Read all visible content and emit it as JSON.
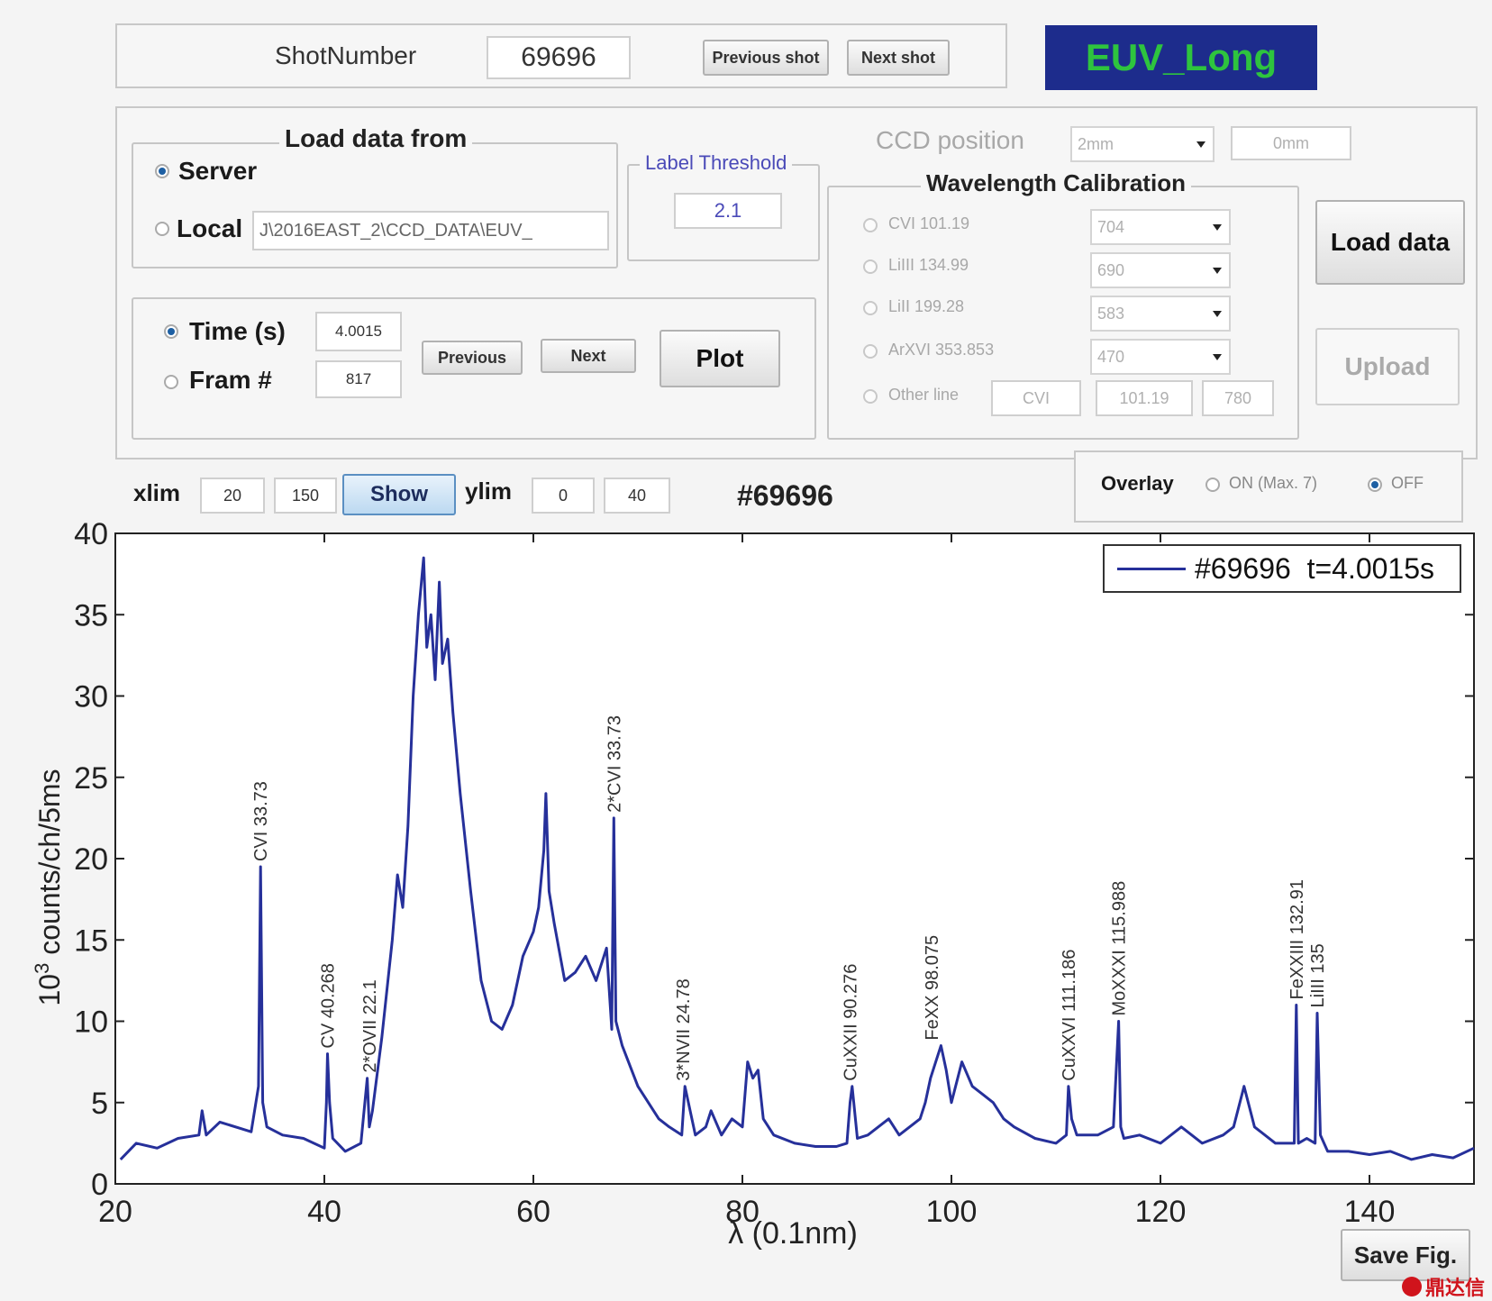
{
  "header": {
    "shot_label": "ShotNumber",
    "shot_value": "69696",
    "prev_shot": "Previous shot",
    "next_shot": "Next shot",
    "title": "EUV_Long",
    "title_bg": "#1d2c8c",
    "title_color": "#2ec43e"
  },
  "load_panel": {
    "title": "Load data from",
    "server_label": "Server",
    "local_label": "Local",
    "local_path": "J\\2016EAST_2\\CCD_DATA\\EUV_",
    "selected": "Server"
  },
  "threshold": {
    "title": "Label Threshold",
    "value": "2.1"
  },
  "ccd": {
    "label": "CCD position",
    "select_value": "2mm",
    "field_value": "0mm"
  },
  "calibration": {
    "title": "Wavelength Calibration",
    "lines": [
      {
        "label": "CVI 101.19",
        "value": "704"
      },
      {
        "label": "LiIII 134.99",
        "value": "690"
      },
      {
        "label": "LiII 199.28",
        "value": "583"
      },
      {
        "label": "ArXVI 353.853",
        "value": "470"
      }
    ],
    "other_label": "Other line",
    "other_values": [
      "CVI",
      "101.19",
      "780"
    ]
  },
  "buttons": {
    "load_data": "Load data",
    "upload": "Upload",
    "plot": "Plot",
    "previous": "Previous",
    "next": "Next",
    "show": "Show",
    "save_fig": "Save Fig."
  },
  "time_panel": {
    "time_label": "Time (s)",
    "time_value": "4.0015",
    "frame_label": "Fram #",
    "frame_value": "817",
    "selected": "Time (s)"
  },
  "limits": {
    "xlim_label": "xlim",
    "xlim_min": "20",
    "xlim_max": "150",
    "ylim_label": "ylim",
    "ylim_min": "0",
    "ylim_max": "40",
    "shot_tag": "#69696"
  },
  "overlay": {
    "label": "Overlay",
    "on_label": "ON (Max. 7)",
    "off_label": "OFF",
    "selected": "OFF"
  },
  "watermark": "鼎达信",
  "chart_data": {
    "type": "line",
    "xlabel": "λ (0.1nm)",
    "ylabel_base": "10",
    "ylabel_exp": "3",
    "ylabel_rest": " counts/ch/5ms",
    "xlim": [
      20,
      150
    ],
    "ylim": [
      0,
      40
    ],
    "xticks": [
      20,
      40,
      60,
      80,
      100,
      120,
      140
    ],
    "yticks": [
      0,
      5,
      10,
      15,
      20,
      25,
      30,
      35,
      40
    ],
    "grid": false,
    "legend_position": "top-right",
    "series_color": "#26309a",
    "series": [
      {
        "name": "#69696  t=4.0015s",
        "x": [
          20.5,
          22,
          24,
          26,
          28,
          28.3,
          28.7,
          30,
          32,
          33,
          33.7,
          33.9,
          34.1,
          34.5,
          36,
          38,
          40,
          40.2,
          40.3,
          40.5,
          40.8,
          42,
          43.5,
          44.1,
          44.3,
          44.6,
          45.5,
          46.5,
          47,
          47.5,
          48,
          48.5,
          49,
          49.5,
          49.8,
          50.2,
          50.6,
          51,
          51.3,
          51.8,
          52.3,
          53,
          54,
          55,
          56,
          57,
          58,
          59,
          60,
          60.5,
          61,
          61.2,
          61.5,
          62,
          63,
          64,
          65,
          66,
          67,
          67.5,
          67.7,
          67.9,
          68.5,
          70,
          72,
          73,
          74.2,
          74.5,
          75.5,
          76.5,
          77,
          78,
          79,
          80,
          80.5,
          81,
          81.5,
          82,
          83,
          85,
          87,
          89,
          90,
          90.3,
          90.5,
          91,
          92,
          93,
          94,
          95,
          96,
          97,
          97.5,
          98,
          98.5,
          99,
          99.5,
          100,
          101,
          102,
          103,
          104,
          105,
          106,
          108,
          110,
          111,
          111.2,
          111.5,
          112,
          114,
          115.5,
          116,
          116.2,
          116.5,
          118,
          120,
          122,
          124,
          126,
          127,
          128,
          129,
          131,
          132.8,
          133,
          133.2,
          134,
          134.8,
          135,
          135.3,
          136,
          138,
          140,
          142,
          144,
          146,
          148,
          150
        ],
        "y": [
          1.5,
          2.5,
          2.2,
          2.8,
          3.0,
          4.5,
          3.0,
          3.8,
          3.4,
          3.2,
          6.0,
          19.5,
          5.0,
          3.5,
          3.0,
          2.8,
          2.2,
          5.0,
          8.0,
          5.0,
          2.8,
          2.0,
          2.5,
          6.5,
          3.5,
          4.5,
          9.0,
          15.0,
          19.0,
          17.0,
          22.0,
          30.0,
          35.0,
          38.5,
          33.0,
          35.0,
          31.0,
          37.0,
          32.0,
          33.5,
          29.0,
          24.0,
          18.0,
          12.5,
          10.0,
          9.5,
          11.0,
          14.0,
          15.5,
          17.0,
          20.5,
          24.0,
          18.0,
          16.0,
          12.5,
          13.0,
          14.0,
          12.5,
          14.5,
          9.5,
          22.5,
          10.0,
          8.5,
          6.0,
          4.0,
          3.5,
          3.0,
          6.0,
          3.0,
          3.5,
          4.5,
          3.0,
          4.0,
          3.5,
          7.5,
          6.5,
          7.0,
          4.0,
          3.0,
          2.5,
          2.3,
          2.3,
          2.5,
          5.0,
          6.0,
          2.8,
          3.0,
          3.5,
          4.0,
          3.0,
          3.5,
          4.0,
          5.0,
          6.5,
          7.5,
          8.5,
          7.0,
          5.0,
          7.5,
          6.0,
          5.5,
          5.0,
          4.0,
          3.5,
          2.8,
          2.5,
          3.0,
          6.0,
          4.0,
          3.0,
          3.0,
          3.5,
          10.0,
          3.5,
          2.8,
          3.0,
          2.5,
          3.5,
          2.5,
          3.0,
          3.5,
          6.0,
          3.5,
          2.5,
          2.5,
          11.0,
          2.5,
          2.8,
          2.5,
          10.5,
          3.0,
          2.0,
          2.0,
          1.8,
          2.0,
          1.5,
          1.8,
          1.6,
          2.2
        ]
      }
    ],
    "annotations": [
      {
        "text": "CVI 33.73",
        "x": 33.9,
        "y": 19.5
      },
      {
        "text": "CV 40.268",
        "x": 40.3,
        "y": 8.0
      },
      {
        "text": "2*OVII 22.1",
        "x": 44.3,
        "y": 6.5
      },
      {
        "text": "2*CVI 33.73",
        "x": 67.7,
        "y": 22.5
      },
      {
        "text": "3*NVII 24.78",
        "x": 74.3,
        "y": 6.0
      },
      {
        "text": "CuXXII 90.276",
        "x": 90.3,
        "y": 6.0
      },
      {
        "text": "FeXX 98.075",
        "x": 98.1,
        "y": 8.5
      },
      {
        "text": "CuXXVI 111.186",
        "x": 111.2,
        "y": 6.0
      },
      {
        "text": "MoXXXI 115.988",
        "x": 116.0,
        "y": 10.0
      },
      {
        "text": "FeXXIII 132.91",
        "x": 133.0,
        "y": 11.0
      },
      {
        "text": "LiIII 135",
        "x": 135.0,
        "y": 10.5
      }
    ]
  }
}
